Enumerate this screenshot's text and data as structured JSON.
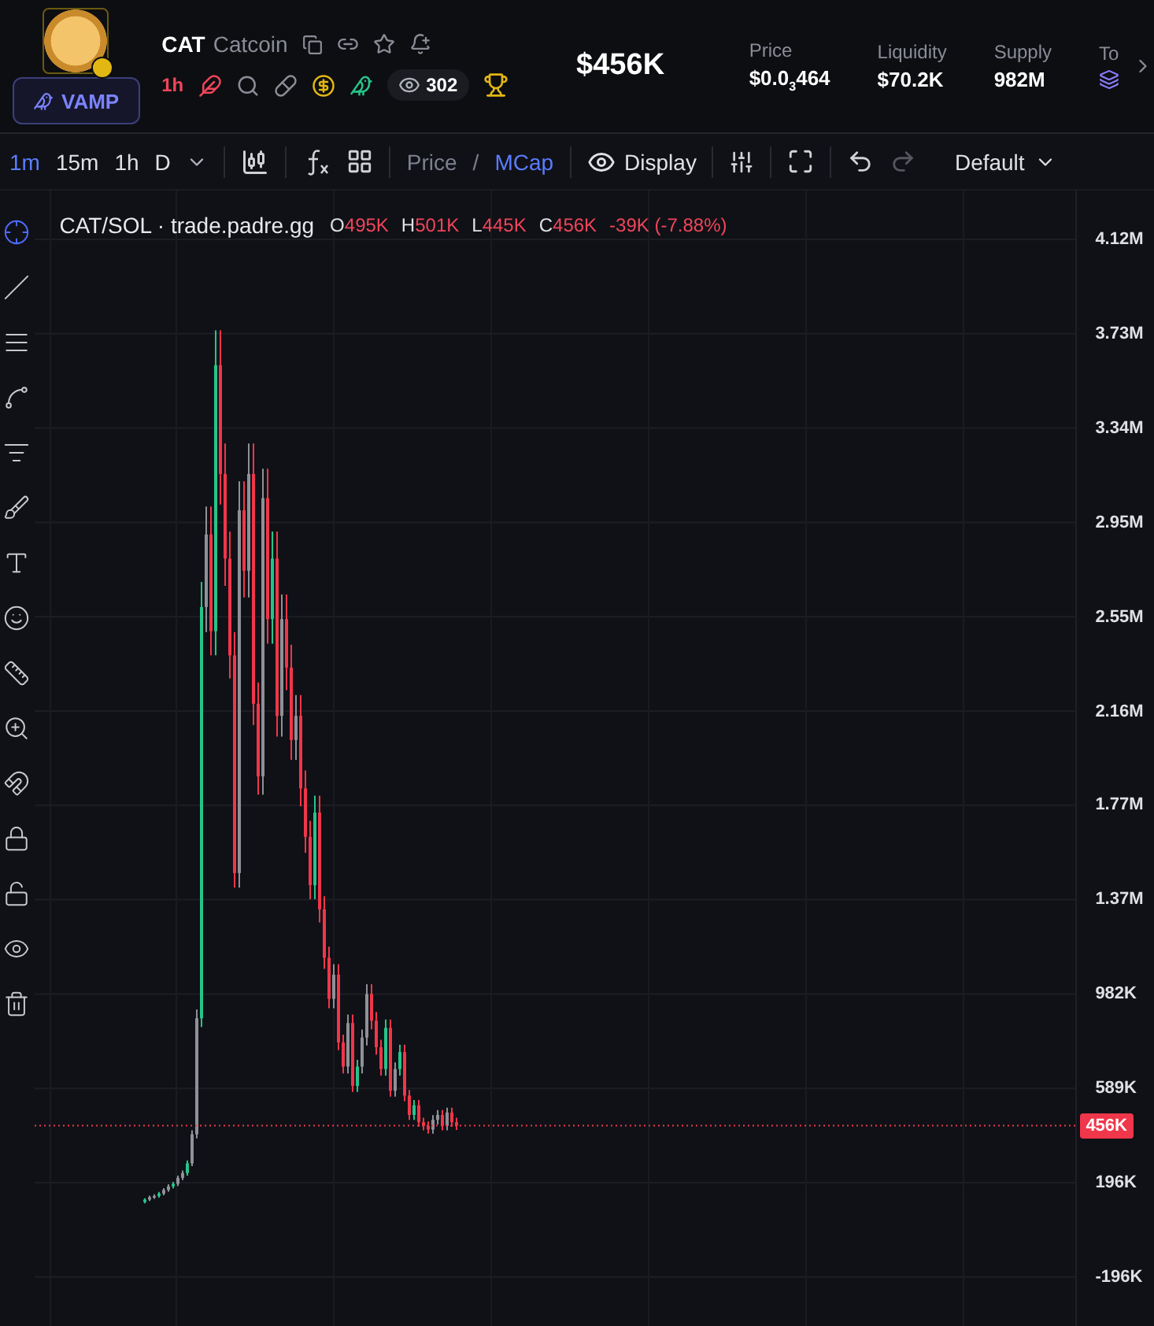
{
  "token": {
    "symbol": "CAT",
    "name": "Catcoin",
    "button": "VAMP",
    "age": "1h",
    "watchers": "302"
  },
  "market_cap": "$456K",
  "stats": [
    {
      "label": "Price",
      "lead": "$0.0",
      "sub": "3",
      "tail": "464"
    },
    {
      "label": "Liquidity",
      "lead": "$70.2K"
    },
    {
      "label": "Supply",
      "lead": "982M"
    },
    {
      "label": "To"
    }
  ],
  "intervals": [
    {
      "label": "1m",
      "selected": true
    },
    {
      "label": "15m",
      "selected": false
    },
    {
      "label": "1h",
      "selected": false
    },
    {
      "label": "D",
      "selected": false
    }
  ],
  "price_mcap": [
    {
      "label": "Price",
      "selected": false
    },
    {
      "label": "/",
      "selected": false
    },
    {
      "label": "MCap",
      "selected": true
    }
  ],
  "display": "Display",
  "layout": "Default",
  "left_tools": [
    {
      "kind": "crosshair",
      "selected": true
    },
    {
      "kind": "trend",
      "selected": false
    },
    {
      "kind": "lines",
      "selected": false
    },
    {
      "kind": "pattern",
      "selected": false
    },
    {
      "kind": "fib",
      "selected": false
    },
    {
      "kind": "brush",
      "selected": false
    },
    {
      "kind": "text",
      "selected": false
    },
    {
      "kind": "smile",
      "selected": false
    },
    {
      "kind": "ruler",
      "selected": false
    },
    {
      "kind": "zoom",
      "selected": false
    },
    {
      "kind": "magnet",
      "selected": false
    },
    {
      "kind": "lock",
      "selected": false
    },
    {
      "kind": "unlock",
      "selected": false
    },
    {
      "kind": "eye",
      "selected": false
    },
    {
      "kind": "trash",
      "selected": false
    }
  ],
  "legend": {
    "pair": "CAT/SOL · trade.padre.gg",
    "ohlc": [
      {
        "key": "O",
        "value": "495K"
      },
      {
        "key": "H",
        "value": "501K"
      },
      {
        "key": "L",
        "value": "445K"
      },
      {
        "key": "C",
        "value": "456K"
      }
    ],
    "change": "-39K (-7.88%)"
  },
  "y_axis": [
    "4.12M",
    "3.73M",
    "3.34M",
    "2.95M",
    "2.55M",
    "2.16M",
    "1.77M",
    "1.37M",
    "982K",
    "589K",
    "196K",
    "-196K"
  ],
  "last_price": "456K"
}
